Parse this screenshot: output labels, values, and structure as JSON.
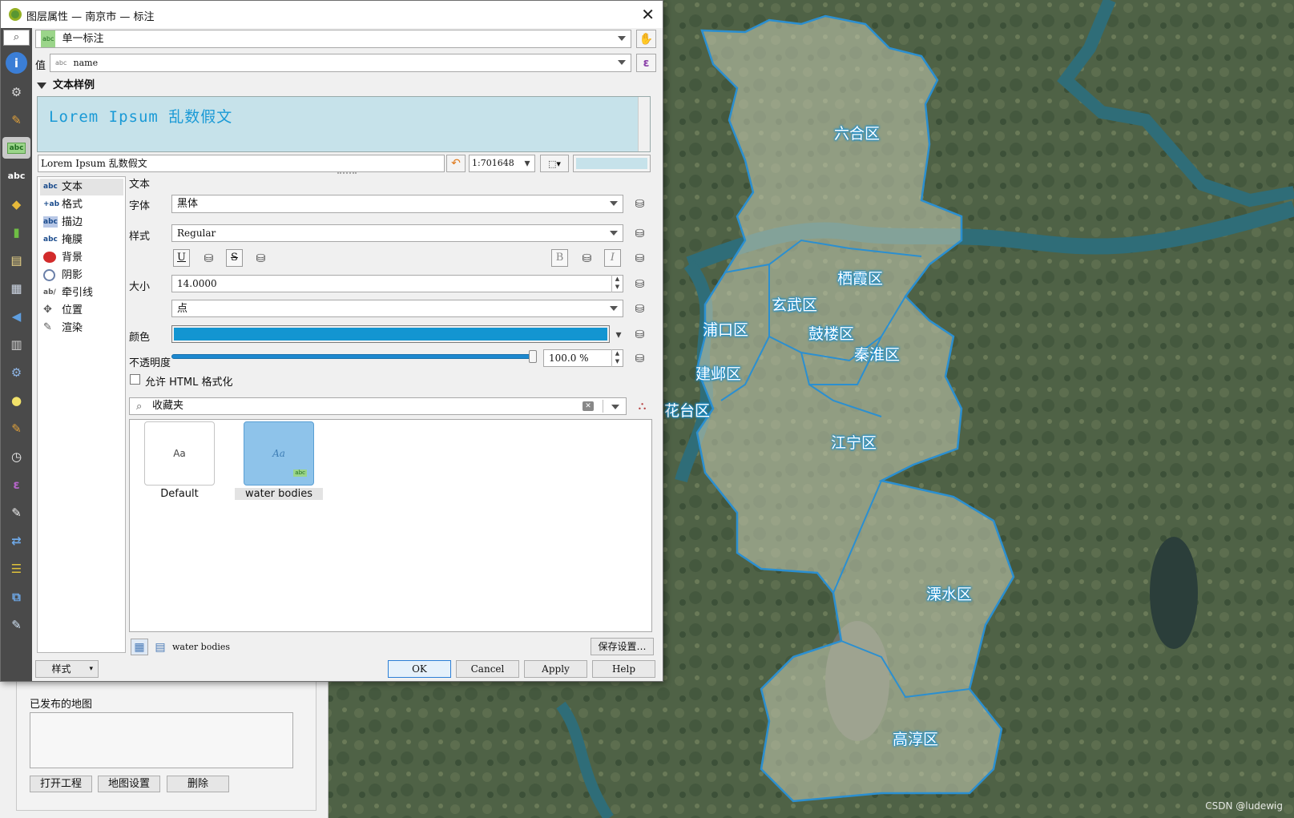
{
  "dialog": {
    "title": "图层属性 — 南京市 — 标注",
    "mode_combo": "单一标注",
    "value_label": "值",
    "value_field": "name",
    "value_field_type": "abc",
    "sample_section": "文本样例",
    "preview_text": "Lorem Ipsum 乱数假文",
    "preview_input": "Lorem Ipsum 乱数假文",
    "scale": "1:701648",
    "preview_bg_color": "#c6e2ea",
    "categories": [
      {
        "label": "文本",
        "icon": "abc"
      },
      {
        "label": "格式",
        "icon": "+ab"
      },
      {
        "label": "描边",
        "icon": "abc"
      },
      {
        "label": "掩膜",
        "icon": "abc"
      },
      {
        "label": "背景",
        "icon": "background-icon"
      },
      {
        "label": "阴影",
        "icon": "shadow-icon"
      },
      {
        "label": "牵引线",
        "icon": "callout-icon"
      },
      {
        "label": "位置",
        "icon": "placement-icon"
      },
      {
        "label": "渲染",
        "icon": "rendering-icon"
      }
    ],
    "text_panel": {
      "heading": "文本",
      "font_label": "字体",
      "font_value": "黑体",
      "style_label": "样式",
      "style_value": "Regular",
      "size_label": "大小",
      "size_value": "14.0000",
      "unit_value": "点",
      "color_label": "颜色",
      "color_value": "#1395d1",
      "opacity_label": "不透明度",
      "opacity_value": "100.0 %",
      "opacity_fraction": 1.0,
      "html_checkbox": "允许 HTML 格式化",
      "html_checked": false,
      "underline": "U",
      "strike": "S",
      "bold": "B",
      "italic": "I"
    },
    "library_search": "收藏夹",
    "styles": [
      {
        "preview": "Aa",
        "name": "Default",
        "selected": false
      },
      {
        "preview": "Aa",
        "name": "water bodies",
        "selected": true
      }
    ],
    "current_style_name": "water bodies",
    "save_settings": "保存设置…",
    "style_button": "样式",
    "buttons": {
      "ok": "OK",
      "cancel": "Cancel",
      "apply": "Apply",
      "help": "Help"
    }
  },
  "background_panel": {
    "group_title": "已发布的地图",
    "buttons": [
      "打开工程",
      "地图设置",
      "删除"
    ]
  },
  "map": {
    "labels": [
      "六合区",
      "栖霞区",
      "玄武区",
      "浦口区",
      "鼓楼区",
      "秦淮区",
      "建邺区",
      "花台区",
      "江宁区",
      "溧水区",
      "高淳区"
    ],
    "label_color": "#ffffff",
    "halo_color": "#1b8fcf",
    "watermark": "CSDN @ludewig"
  }
}
